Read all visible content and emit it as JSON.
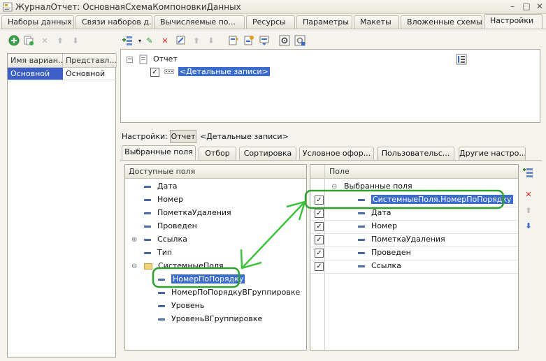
{
  "window": {
    "title": "ЖурналОтчет: ОсновнаяСхемаКомпоновкиДанных",
    "buttons": [
      "–",
      "□",
      "✕"
    ]
  },
  "top_tabs": [
    "Наборы данных",
    "Связи наборов д...",
    "Вычисляемые по...",
    "Ресурсы",
    "Параметры",
    "Макеты",
    "Вложенные схемы",
    "Настройки"
  ],
  "left_grid": {
    "columns": [
      "Имя вариан...",
      "Представл..."
    ],
    "rows": [
      {
        "name": "Основной",
        "presentation": "Основной"
      }
    ]
  },
  "structure": {
    "root": "Отчет",
    "child": "<Детальные записи>"
  },
  "settings": {
    "label": "Настройки:",
    "button": "Отчет",
    "value": "<Детальные записи>"
  },
  "sub_tabs": [
    "Выбранные поля",
    "Отбор",
    "Сортировка",
    "Условное офор...",
    "Пользовательс...",
    "Другие настро..."
  ],
  "available_fields": {
    "header": "Доступные поля",
    "items": [
      "Дата",
      "Номер",
      "ПометкаУдаления",
      "Проведен",
      "Ссылка",
      "Тип",
      "СистемныеПоля",
      "НомерПоПорядку",
      "НомерПоПорядкуВГруппировке",
      "Уровень",
      "УровеньВГруппировке"
    ]
  },
  "selected_fields": {
    "header": "Поле",
    "group": "Выбранные поля",
    "items": [
      "СистемныеПоля.НомерПоПорядку",
      "Дата",
      "Номер",
      "ПометкаУдаления",
      "Проведен",
      "Ссылка"
    ]
  },
  "colors": {
    "selection": "#3a6ccf",
    "highlight": "#2fa12f",
    "arrow": "#3cc23c"
  }
}
